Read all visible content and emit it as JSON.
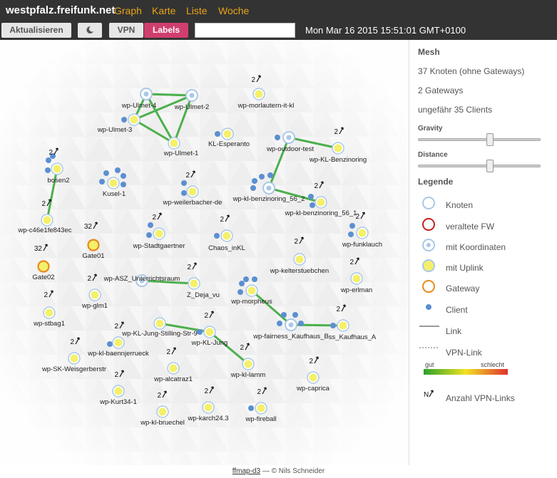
{
  "topbar": {
    "brand": "westpfalz.freifunk.net",
    "nav": [
      "Graph",
      "Karte",
      "Liste",
      "Woche"
    ]
  },
  "toolbar": {
    "refresh": "Aktualisieren",
    "vpn": "VPN",
    "labels": "Labels",
    "search_value": "",
    "clock": "Mon Mar 16 2015 15:51:01 GMT+0100"
  },
  "sidebar": {
    "mesh_title": "Mesh",
    "nodes_count": "37 Knoten (ohne Gateways)",
    "gateways_count": "2 Gateways",
    "clients_count": "ungefähr 35 Clients",
    "gravity_label": "Gravity",
    "gravity_value": 0.58,
    "distance_label": "Distance",
    "distance_value": 0.58,
    "legend_title": "Legende",
    "legend": [
      "Knoten",
      "veraltete FW",
      "mit Koordinaten",
      "mit Uplink",
      "Gateway",
      "Client",
      "Link",
      "VPN-Link"
    ],
    "quality_good": "gut",
    "quality_bad": "schlecht",
    "vpn_count_label": "Anzahl VPN-Links"
  },
  "footer": {
    "link": "ffmap-d3",
    "credit": " — © Nils Schneider"
  },
  "colors": {
    "uplink_fill": "#f5f06a",
    "node_stroke": "#aac8e8",
    "link": "#4cb04c",
    "gateway_stroke": "#e88a1a",
    "client": "#5b8fd1",
    "outdated_stroke": "#c62020",
    "accent": "#d03e6e",
    "nav": "#e8a317"
  },
  "map": {
    "nodes": [
      {
        "name": "wp-Ulmet-4",
        "kind": "coords"
      },
      {
        "name": "wp-Ulmet-2",
        "kind": "coords"
      },
      {
        "name": "wp-Ulmet-3",
        "kind": "uplink"
      },
      {
        "name": "wp-Ulmet-1",
        "kind": "uplink"
      },
      {
        "name": "wp-morlautern-it-kl",
        "kind": "uplink",
        "vpn": "2"
      },
      {
        "name": "KL-Esperanto",
        "kind": "uplink"
      },
      {
        "name": "wp-outdoor-test",
        "kind": "coords"
      },
      {
        "name": "wp-KL-Benzinoring",
        "kind": "uplink",
        "vpn": "2"
      },
      {
        "name": "bosen2",
        "kind": "uplink",
        "vpn": "2"
      },
      {
        "name": "Kusel-1",
        "kind": "uplink"
      },
      {
        "name": "wp-weilerbacher-de",
        "kind": "uplink",
        "vpn": "2"
      },
      {
        "name": "wp-kl-benzinoring_56_2",
        "kind": "coords"
      },
      {
        "name": "wp-kl-benzinoring_56_1",
        "kind": "uplink",
        "vpn": "2"
      },
      {
        "name": "wp-c46e1fe843ec",
        "kind": "uplink",
        "vpn": "2"
      },
      {
        "name": "Gate01",
        "kind": "gateway",
        "vpn": "32"
      },
      {
        "name": "Gate02",
        "kind": "gateway",
        "vpn": "32"
      },
      {
        "name": "wp-Stadtgaertner",
        "kind": "uplink",
        "vpn": "2"
      },
      {
        "name": "Chaos_inKL",
        "kind": "uplink",
        "vpn": "2"
      },
      {
        "name": "wp-funklauch",
        "kind": "uplink",
        "vpn": "2"
      },
      {
        "name": "wp-kelterstuebchen",
        "kind": "uplink",
        "vpn": "2"
      },
      {
        "name": "wp-ASZ_Unterrichtsraum",
        "kind": "coords"
      },
      {
        "name": "Z_Deja_vu",
        "kind": "uplink",
        "vpn": "2"
      },
      {
        "name": "wp-erlman",
        "kind": "uplink",
        "vpn": "2"
      },
      {
        "name": "wp-glm1",
        "kind": "uplink",
        "vpn": "2"
      },
      {
        "name": "wp-morpheus",
        "kind": "uplink"
      },
      {
        "name": "wp-stbag1",
        "kind": "uplink",
        "vpn": "2"
      },
      {
        "name": "wp-fairness_Kaufhaus_B",
        "kind": "coords"
      },
      {
        "name": "ss_Kaufhaus_A",
        "kind": "uplink",
        "vpn": "2"
      },
      {
        "name": "wp-KL-Jung-Stilling-Str-9",
        "kind": "uplink"
      },
      {
        "name": "wp-KL-Jung",
        "kind": "uplink",
        "vpn": "2"
      },
      {
        "name": "wp-kl-baennjerrueck",
        "kind": "uplink",
        "vpn": "2"
      },
      {
        "name": "wp-SK-Weisgerberstr",
        "kind": "uplink",
        "vpn": "2"
      },
      {
        "name": "wp-alcatraz1",
        "kind": "uplink",
        "vpn": "2"
      },
      {
        "name": "wp-kl-lamm",
        "kind": "uplink",
        "vpn": "2"
      },
      {
        "name": "wp-caprica",
        "kind": "uplink",
        "vpn": "2"
      },
      {
        "name": "wp-Kurt34-1",
        "kind": "uplink",
        "vpn": "2"
      },
      {
        "name": "wp-kl-bruechel",
        "kind": "uplink",
        "vpn": "2"
      },
      {
        "name": "wp-karch24.3",
        "kind": "uplink",
        "vpn": "2"
      },
      {
        "name": "wp-fireball",
        "kind": "uplink",
        "vpn": "2"
      },
      {
        "name": "",
        "kind": "uplink",
        "vpn": "2"
      }
    ],
    "links": [
      [
        "wp-Ulmet-4",
        "wp-Ulmet-2"
      ],
      [
        "wp-Ulmet-4",
        "wp-Ulmet-3"
      ],
      [
        "wp-Ulmet-4",
        "wp-Ulmet-1"
      ],
      [
        "wp-Ulmet-2",
        "wp-Ulmet-3"
      ],
      [
        "wp-Ulmet-2",
        "wp-Ulmet-1"
      ],
      [
        "wp-Ulmet-3",
        "wp-Ulmet-1"
      ],
      [
        "wp-outdoor-test",
        "wp-KL-Benzinoring"
      ],
      [
        "wp-outdoor-test",
        "wp-kl-benzinoring_56_2"
      ],
      [
        "wp-kl-benzinoring_56_2",
        "wp-kl-benzinoring_56_1"
      ],
      [
        "bosen2",
        "wp-c46e1fe843ec"
      ],
      [
        "wp-ASZ_Unterrichtsraum",
        "Z_Deja_vu"
      ],
      [
        "wp-morpheus",
        "wp-fairness_Kaufhaus_B"
      ],
      [
        "wp-fairness_Kaufhaus_B",
        "ss_Kaufhaus_A"
      ],
      [
        "wp-KL-Jung-Stilling-Str-9",
        "wp-KL-Jung"
      ],
      [
        "wp-KL-Jung",
        "wp-kl-lamm"
      ]
    ]
  }
}
